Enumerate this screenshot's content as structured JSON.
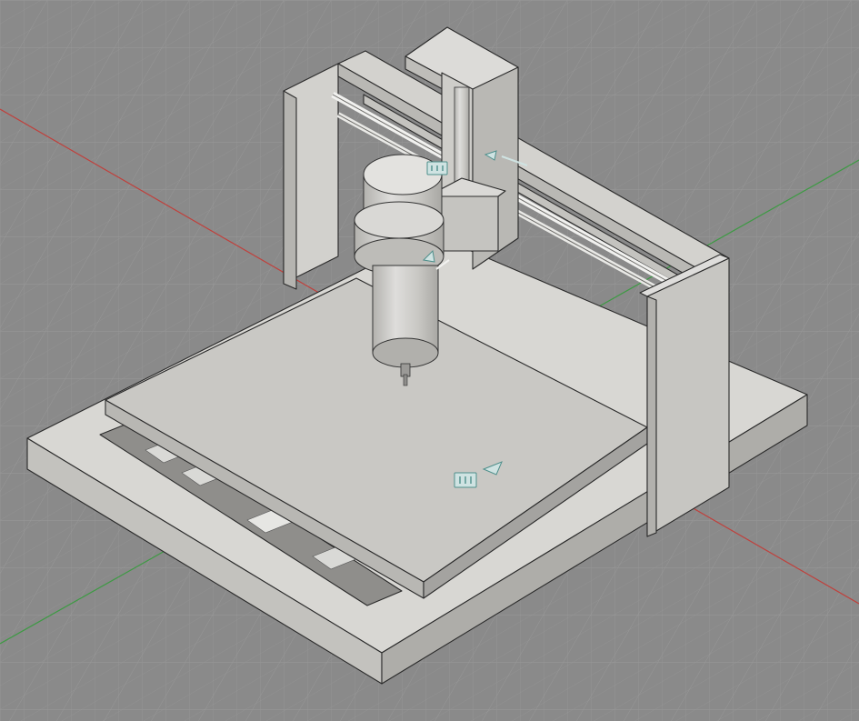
{
  "viewport": {
    "background": "#8a8a8a",
    "grid_color": "#9a9a9a",
    "axis_colors": {
      "x": "#c0403c",
      "y": "#3d9a43"
    }
  },
  "model": {
    "name": "",
    "colors": {
      "light": "#d6d5d1",
      "mid": "#c2c1bd",
      "dark": "#a9a8a4",
      "rail": "#e9e9e6"
    }
  },
  "constraint_glyphs": [
    {
      "name": "joint-icon",
      "at": "gantry-carriage"
    },
    {
      "name": "joint-icon",
      "at": "bed-top"
    },
    {
      "name": "slider-icon",
      "at": "gantry-rail"
    },
    {
      "name": "slider-icon",
      "at": "spindle-mount"
    }
  ]
}
